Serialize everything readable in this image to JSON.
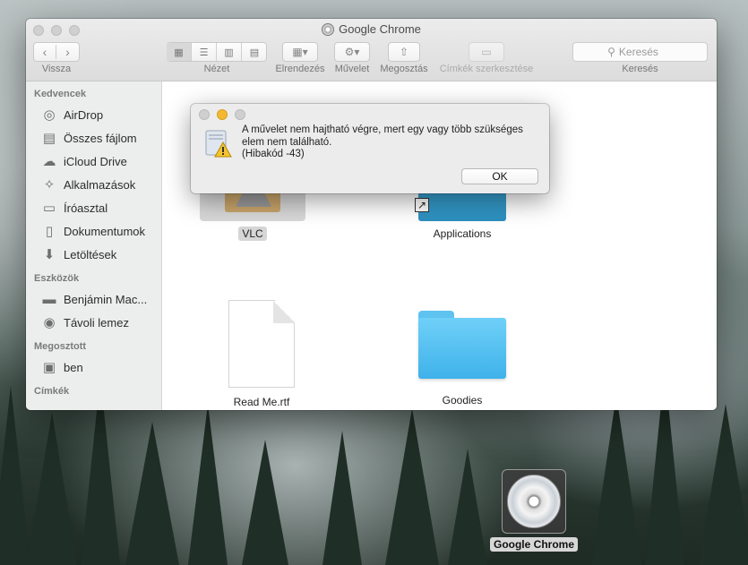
{
  "window": {
    "title": "Google Chrome",
    "toolbar": {
      "back_label": "Vissza",
      "view_label": "Nézet",
      "arrange_label": "Elrendezés",
      "action_label": "Művelet",
      "share_label": "Megosztás",
      "tags_label": "Címkék szerkesztése",
      "search_label": "Keresés",
      "search_placeholder": "Keresés"
    }
  },
  "sidebar": {
    "favorites_heading": "Kedvencek",
    "favorites": [
      {
        "label": "AirDrop",
        "icon": "airdrop-icon"
      },
      {
        "label": "Összes fájlom",
        "icon": "all-files-icon"
      },
      {
        "label": "iCloud Drive",
        "icon": "cloud-icon"
      },
      {
        "label": "Alkalmazások",
        "icon": "applications-icon"
      },
      {
        "label": "Íróasztal",
        "icon": "desktop-icon"
      },
      {
        "label": "Dokumentumok",
        "icon": "documents-icon"
      },
      {
        "label": "Letöltések",
        "icon": "downloads-icon"
      }
    ],
    "devices_heading": "Eszközök",
    "devices": [
      {
        "label": "Benjámin Mac...",
        "icon": "laptop-icon"
      },
      {
        "label": "Távoli lemez",
        "icon": "disc-icon"
      }
    ],
    "shared_heading": "Megosztott",
    "shared": [
      {
        "label": "ben",
        "icon": "monitor-icon"
      }
    ],
    "tags_heading": "Címkék"
  },
  "files": [
    {
      "name": "VLC"
    },
    {
      "name": "Applications"
    },
    {
      "name": "Read Me.rtf"
    },
    {
      "name": "Goodies"
    }
  ],
  "alert": {
    "message": "A művelet nem hajtható végre, mert egy vagy több szükséges elem nem található.",
    "code": "(Hibakód -43)",
    "ok_label": "OK"
  },
  "desktop": {
    "item_label": "Google Chrome"
  }
}
